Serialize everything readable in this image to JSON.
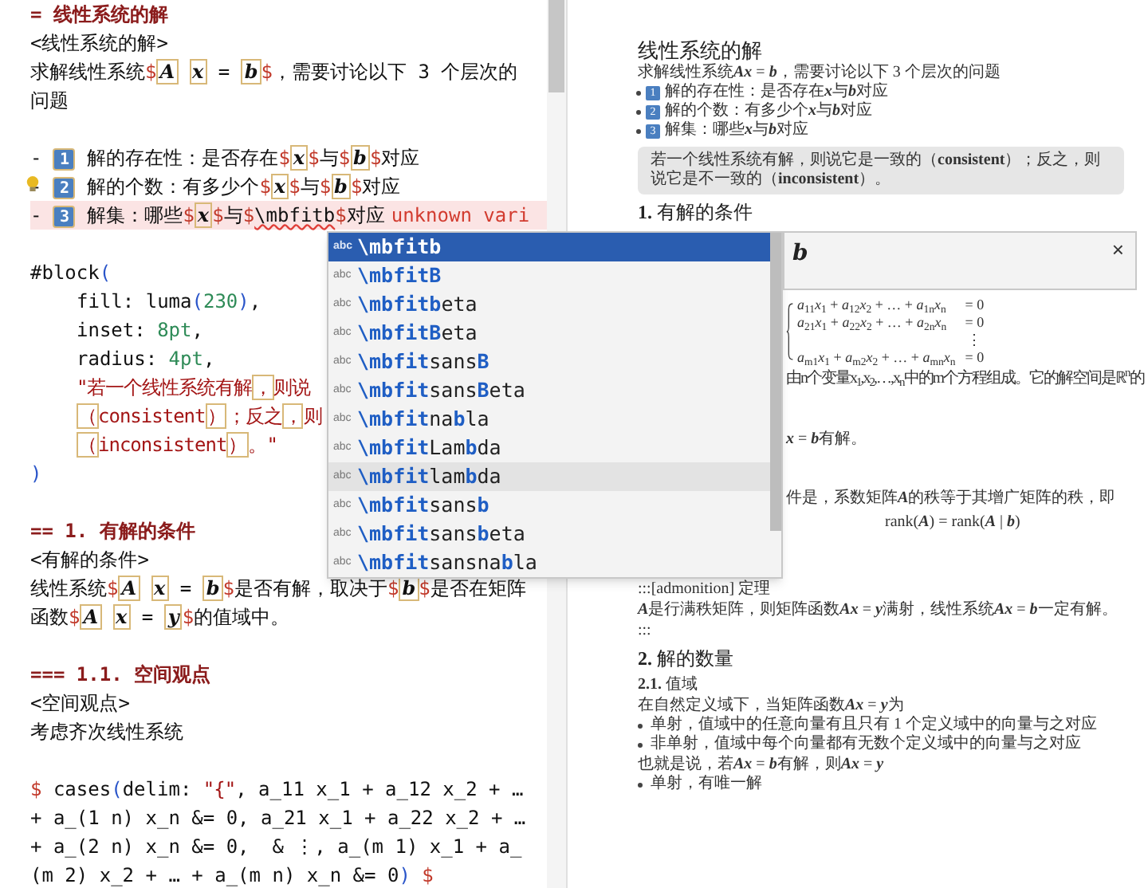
{
  "editor": {
    "lines": [
      {
        "kind": "code",
        "error": false,
        "lightbulb": false,
        "indented": false,
        "segments": [
          {
            "kind": "heading",
            "text": "= 线性系统的解"
          }
        ]
      },
      {
        "kind": "code",
        "error": false,
        "lightbulb": false,
        "indented": false,
        "segments": [
          {
            "kind": "plain",
            "text": "<线性系统的解>"
          }
        ]
      },
      {
        "kind": "code",
        "error": false,
        "lightbulb": false,
        "indented": false,
        "segments": [
          {
            "kind": "plain",
            "text": "求解线性系统"
          },
          {
            "kind": "mdelim",
            "text": "$"
          },
          {
            "kind": "mvar",
            "text": "A"
          },
          {
            "kind": "mvar",
            "text": "x"
          },
          {
            "kind": "plain",
            "text": " = "
          },
          {
            "kind": "mvar",
            "text": "b"
          },
          {
            "kind": "mdelim",
            "text": "$"
          },
          {
            "kind": "plain",
            "text": "，需要讨论以下 3 个层次的"
          }
        ]
      },
      {
        "kind": "code",
        "error": false,
        "lightbulb": false,
        "indented": false,
        "segments": [
          {
            "kind": "plain",
            "text": "问题"
          }
        ]
      },
      {
        "kind": "blank"
      },
      {
        "kind": "code",
        "error": false,
        "lightbulb": false,
        "indented": false,
        "segments": [
          {
            "kind": "plain",
            "text": "- "
          },
          {
            "kind": "marker",
            "text": "1"
          },
          {
            "kind": "plain",
            "text": " 解的存在性：是否存在"
          },
          {
            "kind": "mdelim",
            "text": "$"
          },
          {
            "kind": "mvar",
            "text": "x"
          },
          {
            "kind": "mdelim",
            "text": "$"
          },
          {
            "kind": "plain",
            "text": "与"
          },
          {
            "kind": "mdelim",
            "text": "$"
          },
          {
            "kind": "mvar",
            "text": "b"
          },
          {
            "kind": "mdelim",
            "text": "$"
          },
          {
            "kind": "plain",
            "text": "对应"
          }
        ]
      },
      {
        "kind": "code",
        "error": false,
        "lightbulb": true,
        "indented": false,
        "segments": [
          {
            "kind": "plain",
            "text": "- "
          },
          {
            "kind": "marker",
            "text": "2"
          },
          {
            "kind": "plain",
            "text": " 解的个数：有多少个"
          },
          {
            "kind": "mdelim",
            "text": "$"
          },
          {
            "kind": "mvar",
            "text": "x"
          },
          {
            "kind": "mdelim",
            "text": "$"
          },
          {
            "kind": "plain",
            "text": "与"
          },
          {
            "kind": "mdelim",
            "text": "$"
          },
          {
            "kind": "mvar",
            "text": "b"
          },
          {
            "kind": "mdelim",
            "text": "$"
          },
          {
            "kind": "plain",
            "text": "对应"
          }
        ]
      },
      {
        "kind": "code",
        "error": true,
        "lightbulb": false,
        "indented": false,
        "message": "unknown vari",
        "segments": [
          {
            "kind": "plain",
            "text": "- "
          },
          {
            "kind": "marker",
            "text": "3"
          },
          {
            "kind": "plain",
            "text": " 解集：哪些"
          },
          {
            "kind": "mdelim",
            "text": "$"
          },
          {
            "kind": "mvar",
            "text": "x"
          },
          {
            "kind": "mdelim",
            "text": "$"
          },
          {
            "kind": "plain",
            "text": "与"
          },
          {
            "kind": "mdelim",
            "text": "$"
          },
          {
            "kind": "squiggle",
            "text": "\\mbfitb"
          },
          {
            "kind": "mdelim",
            "text": "$"
          },
          {
            "kind": "plain",
            "text": "对应"
          }
        ]
      },
      {
        "kind": "blank"
      },
      {
        "kind": "code",
        "error": false,
        "lightbulb": false,
        "indented": false,
        "segments": [
          {
            "kind": "plain",
            "text": "#block"
          },
          {
            "kind": "paren",
            "text": "("
          }
        ]
      },
      {
        "kind": "code",
        "error": false,
        "lightbulb": false,
        "indented": true,
        "segments": [
          {
            "kind": "plain",
            "text": "fill: luma"
          },
          {
            "kind": "paren",
            "text": "("
          },
          {
            "kind": "number",
            "text": "230"
          },
          {
            "kind": "paren",
            "text": ")"
          },
          {
            "kind": "plain",
            "text": ","
          }
        ]
      },
      {
        "kind": "code",
        "error": false,
        "lightbulb": false,
        "indented": true,
        "segments": [
          {
            "kind": "plain",
            "text": "inset: "
          },
          {
            "kind": "number",
            "text": "8pt"
          },
          {
            "kind": "plain",
            "text": ","
          }
        ]
      },
      {
        "kind": "code",
        "error": false,
        "lightbulb": false,
        "indented": true,
        "segments": [
          {
            "kind": "plain",
            "text": "radius: "
          },
          {
            "kind": "number",
            "text": "4pt"
          },
          {
            "kind": "plain",
            "text": ","
          }
        ]
      },
      {
        "kind": "code",
        "error": false,
        "lightbulb": false,
        "indented": true,
        "segments": [
          {
            "kind": "string",
            "text": "\"若一个线性系统有解"
          },
          {
            "kind": "sbox",
            "text": "，"
          },
          {
            "kind": "string",
            "text": "则说"
          }
        ]
      },
      {
        "kind": "code",
        "error": false,
        "lightbulb": false,
        "indented": true,
        "segments": [
          {
            "kind": "sbox",
            "text": "（"
          },
          {
            "kind": "string",
            "text": "consistent"
          },
          {
            "kind": "sbox",
            "text": "）"
          },
          {
            "kind": "string",
            "text": "；反之"
          },
          {
            "kind": "sbox",
            "text": "，"
          },
          {
            "kind": "string",
            "text": "则"
          }
        ]
      },
      {
        "kind": "code",
        "error": false,
        "lightbulb": false,
        "indented": true,
        "segments": [
          {
            "kind": "sbox",
            "text": "（"
          },
          {
            "kind": "string",
            "text": "inconsistent"
          },
          {
            "kind": "sbox",
            "text": "）"
          },
          {
            "kind": "string",
            "text": "。\""
          }
        ]
      },
      {
        "kind": "code",
        "error": false,
        "lightbulb": false,
        "indented": false,
        "segments": [
          {
            "kind": "paren",
            "text": ")"
          }
        ]
      },
      {
        "kind": "blank"
      },
      {
        "kind": "code",
        "error": false,
        "lightbulb": false,
        "indented": false,
        "segments": [
          {
            "kind": "heading",
            "text": "== 1. 有解的条件"
          }
        ]
      },
      {
        "kind": "code",
        "error": false,
        "lightbulb": false,
        "indented": false,
        "segments": [
          {
            "kind": "plain",
            "text": "<有解的条件>"
          }
        ]
      },
      {
        "kind": "code",
        "error": false,
        "lightbulb": false,
        "indented": false,
        "segments": [
          {
            "kind": "plain",
            "text": "线性系统"
          },
          {
            "kind": "mdelim",
            "text": "$"
          },
          {
            "kind": "mvar",
            "text": "A"
          },
          {
            "kind": "mvar",
            "text": "x"
          },
          {
            "kind": "plain",
            "text": " = "
          },
          {
            "kind": "mvar",
            "text": "b"
          },
          {
            "kind": "mdelim",
            "text": "$"
          },
          {
            "kind": "plain",
            "text": "是否有解，取决于"
          },
          {
            "kind": "mdelim",
            "text": "$"
          },
          {
            "kind": "mvar",
            "text": "b"
          },
          {
            "kind": "mdelim",
            "text": "$"
          },
          {
            "kind": "plain",
            "text": "是否在矩阵"
          }
        ]
      },
      {
        "kind": "code",
        "error": false,
        "lightbulb": false,
        "indented": false,
        "segments": [
          {
            "kind": "plain",
            "text": "函数"
          },
          {
            "kind": "mdelim",
            "text": "$"
          },
          {
            "kind": "mvar",
            "text": "A"
          },
          {
            "kind": "mvar",
            "text": "x"
          },
          {
            "kind": "plain",
            "text": " = "
          },
          {
            "kind": "mvar",
            "text": "y"
          },
          {
            "kind": "mdelim",
            "text": "$"
          },
          {
            "kind": "plain",
            "text": "的值域中。"
          }
        ]
      },
      {
        "kind": "blank"
      },
      {
        "kind": "code",
        "error": false,
        "lightbulb": false,
        "indented": false,
        "segments": [
          {
            "kind": "heading",
            "text": "=== 1.1. 空间观点"
          }
        ]
      },
      {
        "kind": "code",
        "error": false,
        "lightbulb": false,
        "indented": false,
        "segments": [
          {
            "kind": "plain",
            "text": "<空间观点>"
          }
        ]
      },
      {
        "kind": "code",
        "error": false,
        "lightbulb": false,
        "indented": false,
        "segments": [
          {
            "kind": "plain",
            "text": "考虑齐次线性系统"
          }
        ]
      },
      {
        "kind": "blank"
      },
      {
        "kind": "code",
        "error": false,
        "lightbulb": false,
        "indented": false,
        "segments": [
          {
            "kind": "mdelim",
            "text": "$"
          },
          {
            "kind": "plain",
            "text": " cases"
          },
          {
            "kind": "paren",
            "text": "("
          },
          {
            "kind": "plain",
            "text": "delim: "
          },
          {
            "kind": "string",
            "text": "\"{\""
          },
          {
            "kind": "plain",
            "text": ", a_11 x_1 + a_12 x_2 + …"
          }
        ]
      },
      {
        "kind": "code",
        "error": false,
        "lightbulb": false,
        "indented": false,
        "segments": [
          {
            "kind": "plain",
            "text": "+ a_(1 n) x_n &= 0, a_21 x_1 + a_22 x_2 + …"
          }
        ]
      },
      {
        "kind": "code",
        "error": false,
        "lightbulb": false,
        "indented": false,
        "segments": [
          {
            "kind": "plain",
            "text": "+ a_(2 n) x_n &= 0,  & ⋮, a_(m 1) x_1 + a_"
          }
        ]
      },
      {
        "kind": "code",
        "error": false,
        "lightbulb": false,
        "indented": false,
        "segments": [
          {
            "kind": "plain",
            "text": "(m 2) x_2 + … + a_(m n) x_n &= 0"
          },
          {
            "kind": "paren",
            "text": ")"
          },
          {
            "kind": "mdelim",
            "text": " $"
          }
        ]
      }
    ]
  },
  "completion": {
    "items": [
      {
        "badge": "abc",
        "label": "\\mbfitb",
        "selected": true,
        "highlighted": false
      },
      {
        "badge": "abc",
        "label": "**\\mbfitB**",
        "selected": false,
        "highlighted": false
      },
      {
        "badge": "abc",
        "label": "**\\mbfitb**eta",
        "selected": false,
        "highlighted": false
      },
      {
        "badge": "abc",
        "label": "**\\mbfitB**eta",
        "selected": false,
        "highlighted": false
      },
      {
        "badge": "abc",
        "label": "**\\mbfit**sans**B**",
        "selected": false,
        "highlighted": false
      },
      {
        "badge": "abc",
        "label": "**\\mbfit**sans**B**eta",
        "selected": false,
        "highlighted": false
      },
      {
        "badge": "abc",
        "label": "**\\mbfit**na**b**la",
        "selected": false,
        "highlighted": false
      },
      {
        "badge": "abc",
        "label": "**\\mbfit**Lam**b**da",
        "selected": false,
        "highlighted": false
      },
      {
        "badge": "abc",
        "label": "**\\mbfit**lam**b**da",
        "selected": false,
        "highlighted": true
      },
      {
        "badge": "abc",
        "label": "**\\mbfit**sans**b**",
        "selected": false,
        "highlighted": false
      },
      {
        "badge": "abc",
        "label": "**\\mbfit**sans**b**eta",
        "selected": false,
        "highlighted": false
      },
      {
        "badge": "abc",
        "label": "**\\mbfit**sansna**b**la",
        "selected": false,
        "highlighted": false
      }
    ],
    "detail": {
      "symbol": "b",
      "close": "×"
    }
  },
  "preview": {
    "items": [
      {
        "kind": "title",
        "text": "线性系统的解"
      },
      {
        "kind": "para",
        "text": "求解线性系统**Ax** = **b**，需要讨论以下 3 个层次的问题"
      },
      {
        "kind": "bullet",
        "marker": "1",
        "text": "解的存在性：是否存在**x**与**b**对应"
      },
      {
        "kind": "bullet",
        "marker": "2",
        "text": "解的个数：有多少个**x**与**b**对应"
      },
      {
        "kind": "bullet",
        "marker": "3",
        "text": "解集：哪些**x**与**b**对应"
      },
      {
        "kind": "quote",
        "text": "若一个线性系统有解，则说它是一致的（**consistent**）；反之，则说它是不一致的（**inconsistent**）。"
      },
      {
        "kind": "h2",
        "text": "**1.** 有解的条件"
      },
      {
        "kind": "system",
        "rows": [
          {
            "lhs": "*a*$_{11}$*x*$_{1}$ + *a*$_{12}$*x*$_{2}$ + … + *a*$_{1n}$*x*$_{n}$",
            "rhs": "= 0"
          },
          {
            "lhs": "*a*$_{21}$*x*$_{1}$ + *a*$_{22}$*x*$_{2}$ + … + *a*$_{2n}$*x*$_{n}$",
            "rhs": "= 0"
          },
          {
            "rhs": "⋮"
          },
          {
            "lhs": "*a*$_{m1}$*x*$_{1}$ + *a*$_{m2}$*x*$_{2}$ + … + *a*$_{mn}$*x*$_{n}$",
            "rhs": "= 0"
          }
        ]
      },
      {
        "kind": "partial",
        "text": "由n个变量x$_{1}$,x$_{2}$,…,x$_{n}$中的m个方程组成。它的解空间是ℝ$^{n}$的"
      },
      {
        "kind": "partial-gap",
        "text": "**x** = **b**有解。"
      },
      {
        "kind": "partial-gap",
        "text": "件是，系数矩阵**A**的秩等于其增广矩阵的秩，即"
      },
      {
        "kind": "center",
        "text": "rank(**A**) = rank(**A** | **b**)"
      },
      {
        "kind": "admon",
        "text": ":::[admonition] 定理"
      },
      {
        "kind": "para",
        "text": "**A**是行满秩矩阵，则矩阵函数**Ax** = **y**满射，线性系统**Ax** = **b**一定有解。"
      },
      {
        "kind": "para",
        "text": ":::"
      },
      {
        "kind": "h2",
        "text": "**2.** 解的数量"
      },
      {
        "kind": "h3",
        "text": "**2.1.** 值域"
      },
      {
        "kind": "para",
        "text": "在自然定义域下，当矩阵函数**Ax** = **y**为"
      },
      {
        "kind": "dot",
        "text": "单射，值域中的任意向量有且只有 1 个定义域中的向量与之对应"
      },
      {
        "kind": "dot",
        "text": "非单射，值域中每个向量都有无数个定义域中的向量与之对应"
      },
      {
        "kind": "para",
        "text": "也就是说，若**Ax** = **b**有解，则**Ax** = **y**"
      },
      {
        "kind": "dot",
        "text": "单射，有唯一解"
      }
    ]
  }
}
